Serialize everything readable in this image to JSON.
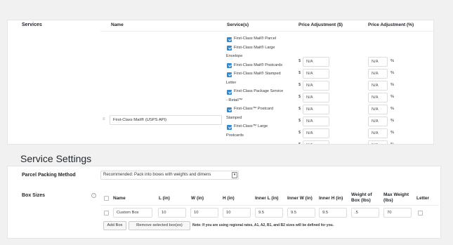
{
  "services": {
    "section_label": "Services",
    "headers": {
      "name": "Name",
      "services": "Service(s)",
      "price_adj": "Price Adjustment ($)",
      "price_adj_pct": "Price Adjustment (%)"
    },
    "row_name_value": "First-Class Mail® (USPS API)",
    "items": [
      {
        "lines": [
          "First-Class Mail® Parcel"
        ],
        "checked": true
      },
      {
        "lines": [
          "First-Class Mail® Large",
          "Envelope"
        ],
        "checked": true
      },
      {
        "lines": [
          "First-Class Mail® Postcards"
        ],
        "checked": true
      },
      {
        "lines": [
          "First-Class Mail® Stamped",
          "Letter"
        ],
        "checked": true
      },
      {
        "lines": [
          "First-Class Package Service",
          "- Retail™"
        ],
        "checked": true
      },
      {
        "lines": [
          "First-Class™ Postcard",
          "Stamped"
        ],
        "checked": true
      },
      {
        "lines": [
          "First-Class™ Large",
          "Postcards"
        ],
        "checked": true
      }
    ],
    "currency_symbol": "$",
    "percent_symbol": "%",
    "na_placeholder": "N/A",
    "adjustment_rows": 8,
    "accent_color": "#2e8bd6"
  },
  "service_settings": {
    "title": "Service Settings",
    "packing_label": "Parcel Packing Method",
    "packing_value": "Recommended: Pack into boxes with weights and dimens",
    "box_sizes_label": "Box Sizes",
    "box_headers": {
      "name": "Name",
      "l": "L (in)",
      "w": "W (in)",
      "h": "H (in)",
      "inner_l": "Inner L (in)",
      "inner_w": "Inner W (in)",
      "inner_h": "Inner H (in)",
      "weight": "Weight of Box (lbs)",
      "max_weight": "Max Weight (lbs)",
      "letter": "Letter"
    },
    "box_row": {
      "name": "Custom Box",
      "l": "10",
      "w": "10",
      "h": "10",
      "inner_l": "9.5",
      "inner_w": "9.5",
      "inner_h": "9.5",
      "weight": ".5",
      "max_weight": "70"
    },
    "add_box": "Add Box",
    "remove_box": "Remove selected box(es)",
    "note": "Note: If you are using regional rates, A1, A2, B1, and B2 sizes will be defined for you."
  }
}
